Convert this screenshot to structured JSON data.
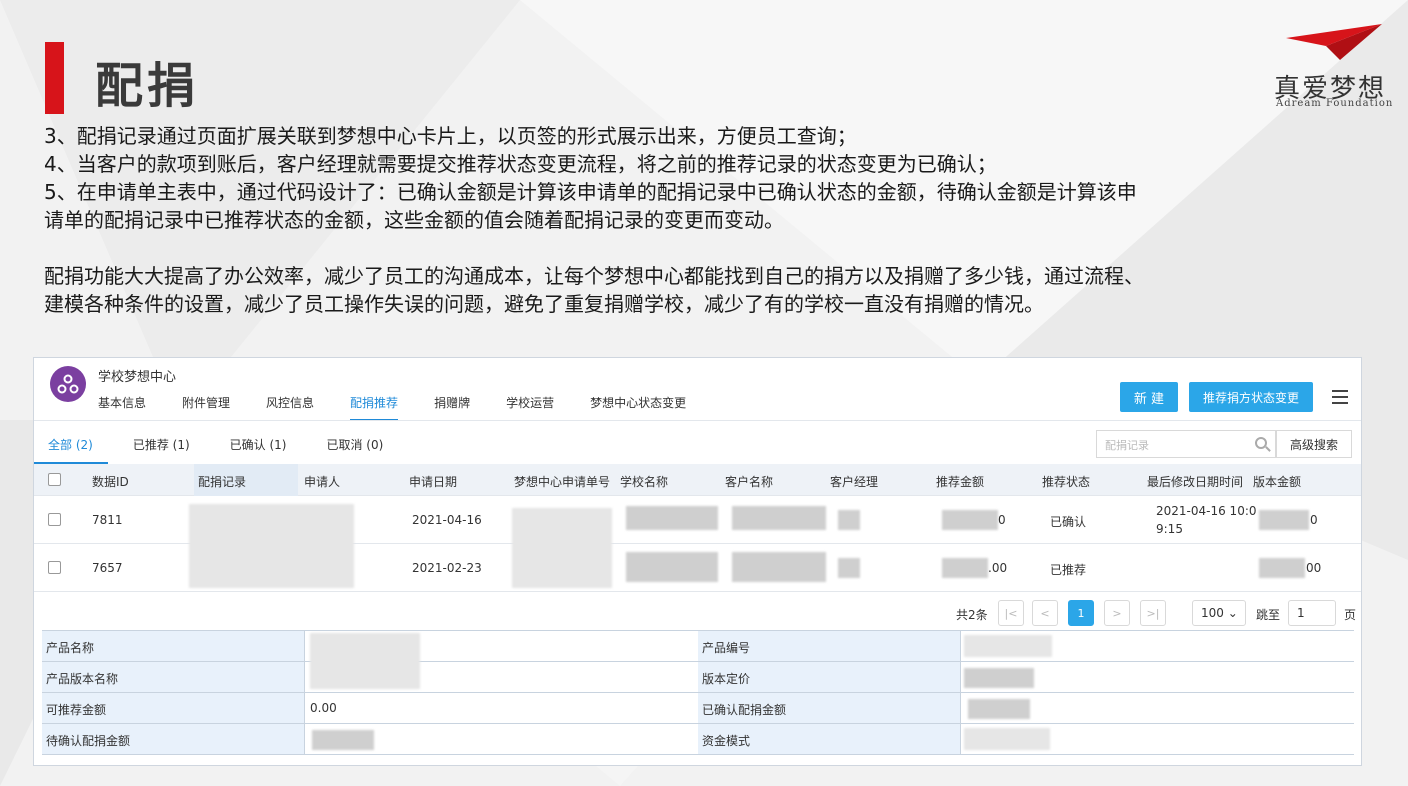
{
  "slide": {
    "title": "配捐",
    "logo_cn": "真爱梦想",
    "logo_en": "Adream Foundation",
    "brand_color": "#d7141a",
    "paragraphs": [
      "3、配捐记录通过页面扩展关联到梦想中心卡片上，以页签的形式展示出来，方便员工查询；",
      "4、当客户的款项到账后，客户经理就需要提交推荐状态变更流程，将之前的推荐记录的状态变更为已确认；",
      "5、在申请单主表中，通过代码设计了：已确认金额是计算该申请单的配捐记录中已确认状态的金额，待确认金额是计算该申",
      "请单的配捐记录中已推荐状态的金额，这些金额的值会随着配捐记录的变更而变动。",
      "配捐功能大大提高了办公效率，减少了员工的沟通成本，让每个梦想中心都能找到自己的捐方以及捐赠了多少钱，通过流程、",
      "建模各种条件的设置，减少了员工操作失误的问题，避免了重复捐赠学校，减少了有的学校一直没有捐赠的情况。"
    ]
  },
  "app": {
    "name": "学校梦想中心",
    "tabs": [
      "基本信息",
      "附件管理",
      "风控信息",
      "配捐推荐",
      "捐赠牌",
      "学校运营",
      "梦想中心状态变更"
    ],
    "active_tab": "配捐推荐",
    "new_button": "新 建",
    "change_button": "推荐捐方状态变更",
    "accent_color": "#2ba6e8",
    "subtabs": [
      "全部 (2)",
      "已推荐 (1)",
      "已确认 (1)",
      "已取消 (0)"
    ],
    "search_placeholder": "配捐记录",
    "advanced_search": "高级搜索",
    "columns": [
      "数据ID",
      "配捐记录",
      "申请人",
      "申请日期",
      "梦想中心申请单号",
      "学校名称",
      "客户名称",
      "客户经理",
      "推荐金额",
      "推荐状态",
      "最后修改日期时间",
      "版本金额"
    ],
    "rows": [
      {
        "id": "7811",
        "date": "2021-04-16",
        "amount_tail": "0",
        "status": "已确认",
        "modified_1": "2021-04-16 10:0",
        "modified_2": "9:15",
        "version_tail": "0"
      },
      {
        "id": "7657",
        "date": "2021-02-23",
        "amount_tail": ".00",
        "status": "已推荐",
        "modified_1": "",
        "modified_2": "",
        "version_tail": "00"
      }
    ],
    "pager": {
      "total": "共2条",
      "first": "|<",
      "prev": "<",
      "current": "1",
      "next": ">",
      "last": ">|",
      "page_size": "100",
      "jump_label": "跳至",
      "jump_value": "1",
      "page_unit": "页"
    },
    "detail": {
      "product_name": "产品名称",
      "product_code": "产品编号",
      "version_name": "产品版本名称",
      "version_price": "版本定价",
      "recommendable_amount": "可推荐金额",
      "recommendable_value": "0.00",
      "confirmed_amount": "已确认配捐金额",
      "pending_amount": "待确认配捐金额",
      "fund_mode": "资金模式"
    }
  }
}
